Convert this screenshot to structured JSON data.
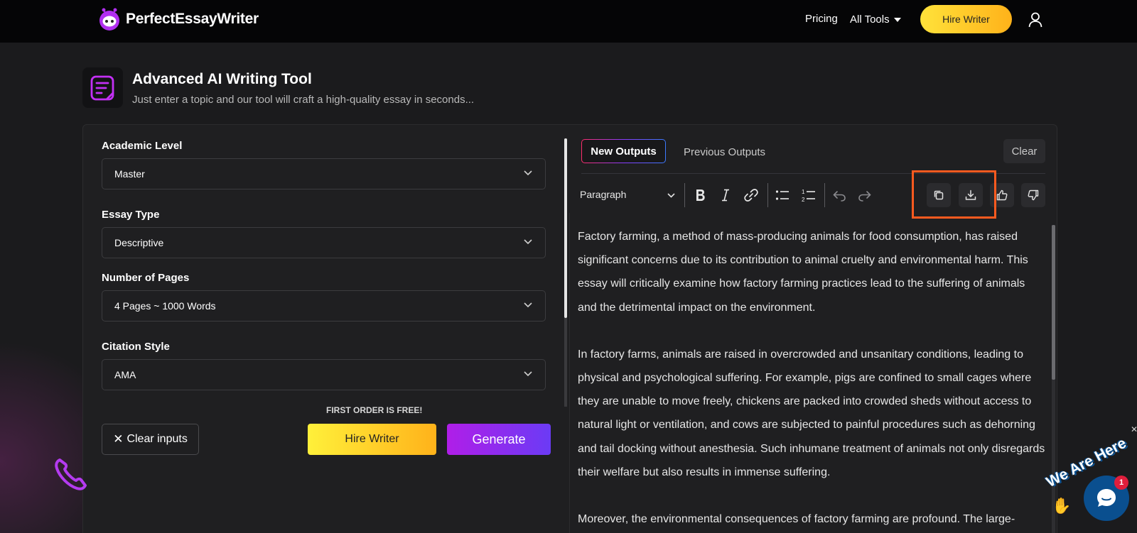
{
  "nav": {
    "brand": "PerfectEssayWriter",
    "pricing": "Pricing",
    "all_tools": "All Tools",
    "hire_writer": "Hire Writer"
  },
  "header": {
    "title": "Advanced AI Writing Tool",
    "subtitle": "Just enter a topic and our tool will craft a high-quality essay in seconds..."
  },
  "form": {
    "fields": [
      {
        "label": "Academic Level",
        "value": "Master"
      },
      {
        "label": "Essay Type",
        "value": "Descriptive"
      },
      {
        "label": "Number of Pages",
        "value": "4 Pages ~ 1000 Words"
      },
      {
        "label": "Citation Style",
        "value": "AMA"
      }
    ],
    "first_order_note": "FIRST ORDER IS FREE!",
    "clear_inputs": "Clear inputs",
    "hire_writer": "Hire Writer",
    "generate": "Generate"
  },
  "output": {
    "tab_new": "New Outputs",
    "tab_previous": "Previous Outputs",
    "clear": "Clear",
    "block_format": "Paragraph",
    "paragraphs": [
      "Factory farming, a method of mass-producing animals for food consumption, has raised significant concerns due to its contribution to animal cruelty and environmental harm. This essay will critically examine how factory farming practices lead to the suffering of animals and the detrimental impact on the environment.",
      "In factory farms, animals are raised in overcrowded and unsanitary conditions, leading to physical and psychological suffering. For example, pigs are confined to small cages where they are unable to move freely, chickens are packed into crowded sheds without access to natural light or ventilation, and cows are subjected to painful procedures such as dehorning and tail docking without anesthesia. Such inhumane treatment of animals not only disregards their welfare but also results in immense suffering.",
      "Moreover, the environmental consequences of factory farming are profound. The large-"
    ]
  },
  "chat": {
    "tagline": "We Are Here",
    "badge_count": "1"
  },
  "colors": {
    "accent_purple": "#a020f0",
    "hire_yellow": "#ffd52a",
    "highlight_orange": "#ff5a1f"
  }
}
